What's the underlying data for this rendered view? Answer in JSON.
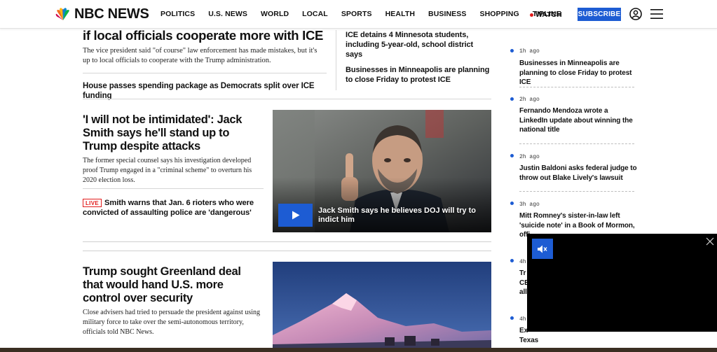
{
  "header": {
    "brand": "NBC NEWS",
    "nav": [
      "POLITICS",
      "U.S. NEWS",
      "WORLD",
      "LOCAL",
      "SPORTS",
      "HEALTH",
      "BUSINESS",
      "SHOPPING",
      "TIPLINE"
    ],
    "watch_label": "WATCH",
    "subscribe_label": "SUBSCRIBE",
    "accent_color": "#1d5cd3",
    "live_color": "#e21c1c"
  },
  "top_story": {
    "headline": "if local officials cooperate more with ICE",
    "dek": "The vice president said \"of course\" law enforcement has made mistakes, but it's up to local officials to cooperate with the Trump administration.",
    "related": "House passes spending package as Democrats split over ICE funding",
    "side_stories": [
      "ICE detains 4 Minnesota students, including 5-year-old, school district says",
      "Businesses in Minneapolis are planning to close Friday to protest ICE"
    ]
  },
  "story2": {
    "headline": "'I will not be intimidated': Jack Smith says he'll stand up to Trump despite attacks",
    "dek": "The former special counsel says his investigation developed proof Trump engaged in a \"criminal scheme\" to overturn his 2020 election loss.",
    "live_badge": "LIVE",
    "related": "Smith warns that Jan. 6 rioters who were convicted of assaulting police are 'dangerous'",
    "video_caption": "Jack Smith says he believes DOJ will try to indict him"
  },
  "story3": {
    "headline": "Trump sought Greenland deal that would hand U.S. more control over security",
    "dek": "Close advisers had tried to persuade the president against using military force to take over the semi-autonomous territory, officials told NBC News."
  },
  "feed": [
    {
      "time": "1h ago",
      "title": "Businesses in Minneapolis are planning to close Friday to protest ICE"
    },
    {
      "time": "2h ago",
      "title": "Fernando Mendoza wrote a LinkedIn update about winning the national title"
    },
    {
      "time": "2h ago",
      "title": "Justin Baldoni asks federal judge to throw out Blake Lively's lawsuit"
    },
    {
      "time": "3h ago",
      "title": "Mitt Romney's sister-in-law left 'suicide note' in a Book of Mormon, offi"
    },
    {
      "time": "4h",
      "title": "Tr CE all"
    },
    {
      "time": "4h",
      "title": "Ex Texas"
    }
  ]
}
